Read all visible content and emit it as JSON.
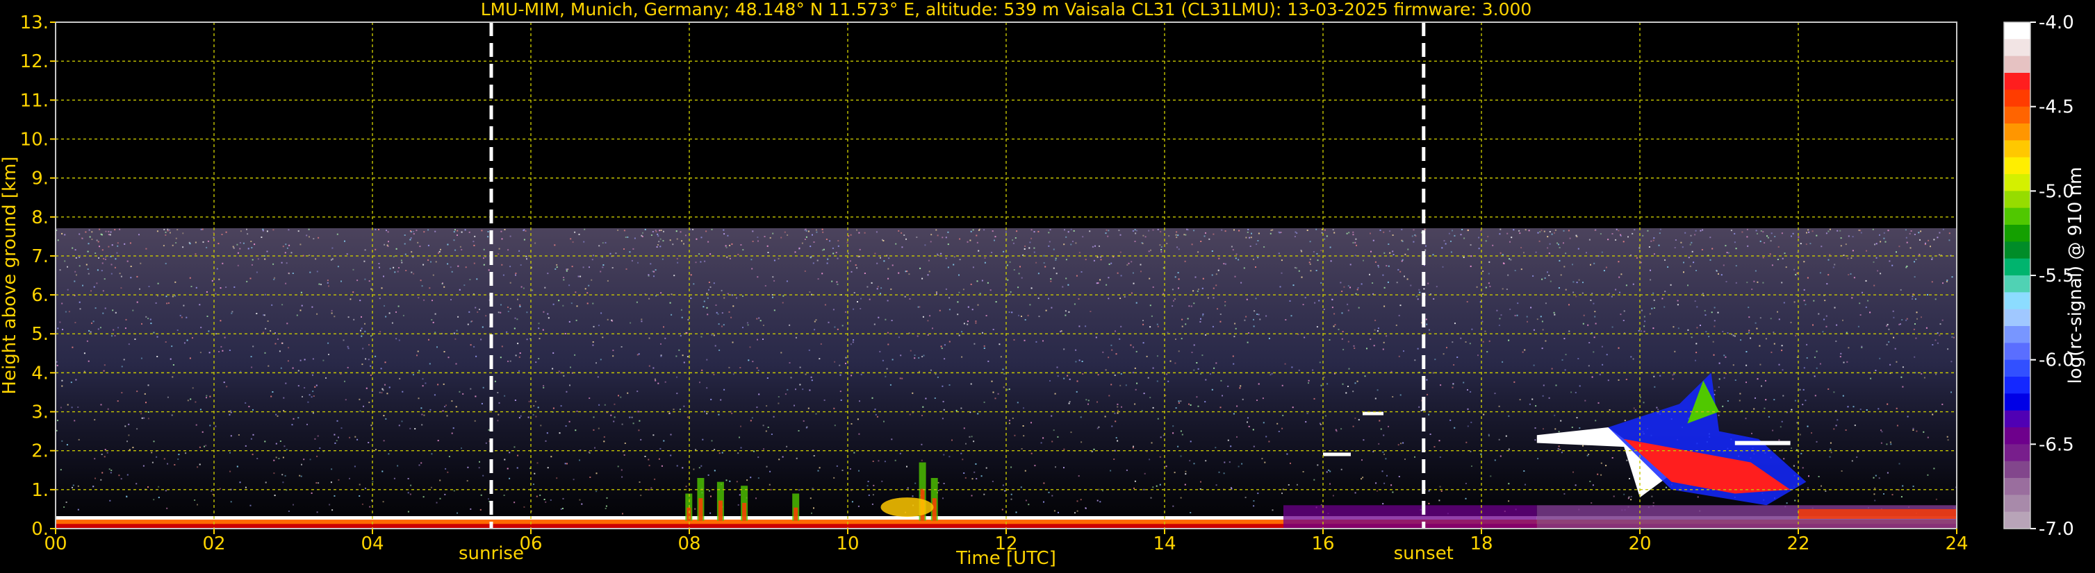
{
  "chart_data": {
    "type": "heatmap",
    "title": "LMU-MIM, Munich, Germany; 48.148° N 11.573° E, altitude: 539 m    Vaisala CL31 (CL31LMU): 13-03-2025    firmware: 3.000",
    "xlabel": "Time [UTC]",
    "ylabel": "Height above ground [km]",
    "xlim": [
      0,
      24
    ],
    "ylim": [
      0,
      13
    ],
    "x_ticks": [
      "00",
      "02",
      "04",
      "06",
      "08",
      "10",
      "12",
      "14",
      "16",
      "18",
      "20",
      "22",
      "24"
    ],
    "y_ticks": [
      "0.",
      "1.",
      "2.",
      "3.",
      "4.",
      "5.",
      "6.",
      "7.",
      "8.",
      "9.",
      "10.",
      "11.",
      "12.",
      "13."
    ],
    "grid": true,
    "markers": [
      {
        "label": "sunrise",
        "x": 5.5
      },
      {
        "label": "sunset",
        "x": 17.27
      }
    ],
    "colorbar": {
      "label": "log(rc-signal) @ 910 nm",
      "range": [
        -7.0,
        -4.0
      ],
      "ticks": [
        "-4.0",
        "-4.5",
        "-5.0",
        "-5.5",
        "-6.0",
        "-6.5",
        "-7.0"
      ],
      "colors": [
        "#ffffff",
        "#f2e4e4",
        "#e6c2c2",
        "#ff1e1e",
        "#ff3c00",
        "#ff6400",
        "#ff9600",
        "#ffc800",
        "#ffee00",
        "#d4f000",
        "#96dc00",
        "#50c800",
        "#14a000",
        "#008c28",
        "#00b46e",
        "#50d2b4",
        "#8cdcff",
        "#a0c8ff",
        "#7896ff",
        "#5a6eff",
        "#3250ff",
        "#1428ff",
        "#0000e6",
        "#5000b4",
        "#6e008c",
        "#781e8c",
        "#82468c",
        "#9a6e9e",
        "#a88aaa",
        "#b8a4b8"
      ]
    },
    "layers": [
      {
        "name": "background noise top",
        "x": [
          0,
          24
        ],
        "y": [
          0,
          7.7
        ]
      },
      {
        "name": "boundary layer",
        "x": [
          0,
          24
        ],
        "y": [
          0,
          0.35
        ]
      },
      {
        "name": "aerosol plumes",
        "x": [
          7.8,
          11.2
        ],
        "y": [
          0,
          1.7
        ]
      },
      {
        "name": "cloud layer",
        "x": [
          18.7,
          22.4
        ],
        "y": [
          0.3,
          4.0
        ]
      }
    ]
  }
}
